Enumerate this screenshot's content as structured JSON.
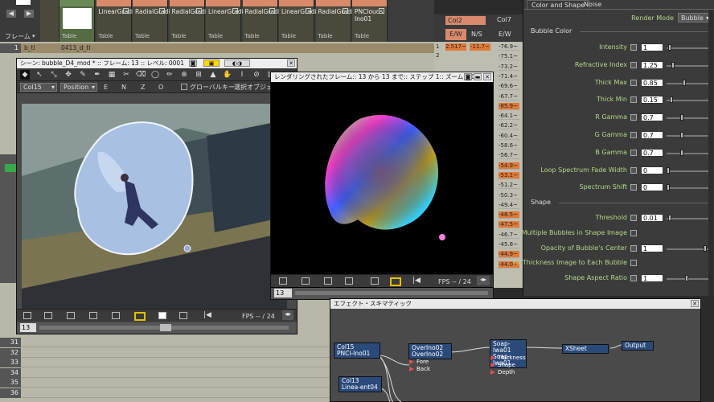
{
  "top_left": {
    "frame_label": "フレーム",
    "row_label": "1",
    "cell_value": "b_tl",
    "cell_value2": "0413_d_tl"
  },
  "columns": [
    {
      "name": "",
      "footer": ""
    },
    {
      "name": "",
      "footer": "Table"
    },
    {
      "name": "LinearGradient01",
      "footer": "Table"
    },
    {
      "name": "RadialGradient05",
      "footer": "Table"
    },
    {
      "name": "RadialGradient02",
      "footer": "Table"
    },
    {
      "name": "LinearGradient02",
      "footer": "Table"
    },
    {
      "name": "RadialGradient03",
      "footer": "Table"
    },
    {
      "name": "LinearGradient04",
      "footer": "Table"
    },
    {
      "name": "RadialGradient04",
      "footer": "Table"
    },
    {
      "name": "PNClouds Ino01",
      "footer": "Table"
    }
  ],
  "xsheet_rows": [
    "31",
    "32",
    "33",
    "34",
    "35",
    "36"
  ],
  "numcols": {
    "col2_label": "Col2",
    "col7_label": "Col7",
    "hdr_ew": "E/W",
    "hdr_ns": "N/S",
    "hdr_ew2": "E/W",
    "row1": [
      "1",
      "2.517~",
      "-11.7~",
      "-76.9~"
    ],
    "row2": "2",
    "col7_values": [
      "-76.9~",
      "-75.1~",
      "-73.2~",
      "-71.4~",
      "-69.6~",
      "-67.7~",
      "-85.9~",
      "-64.1~",
      "-62.2~",
      "-60.4~",
      "-58.6~",
      "-56.7~",
      "-54.9~",
      "-53.1~",
      "-51.2~",
      "-50.3~",
      "-49.4~",
      "-48.5~",
      "-47.5~",
      "-46.7~",
      "-45.8~",
      "-44.9~",
      "-44.0~"
    ]
  },
  "scene_window": {
    "title": "シーン: bubble_D4_mod * :: フレーム: 13 :: レベル: 0001",
    "column_select": "Col15",
    "mode_select": "Position",
    "global_key": "グローバルキー",
    "select_object": "選択オブジェ",
    "fps": "FPS -- / 24",
    "frame": "13",
    "axes": [
      "E",
      "N",
      "Z",
      "O"
    ]
  },
  "render_window": {
    "title": "レンダリングされたフレーム:: 13 から 13 まで:: ステップ 1:: ズーム: 10",
    "fps": "FPS -- / 24",
    "frame": "13"
  },
  "params": {
    "tabs": [
      "Color and Shape",
      "Noise"
    ],
    "render_mode_label": "Render Mode",
    "render_mode_value": "Bubble",
    "section_bubble_color": "Bubble Color",
    "section_shape": "Shape",
    "fields": [
      {
        "label": "Intensity",
        "value": "1",
        "level": 0.05
      },
      {
        "label": "Refractive Index",
        "value": "1.25",
        "level": 0.12
      },
      {
        "label": "Thick Max",
        "value": "0.85",
        "level": 0.42
      },
      {
        "label": "Thick Min",
        "value": "0.15",
        "level": 0.08
      },
      {
        "label": "R Gamma",
        "value": "0.7",
        "level": 0.35
      },
      {
        "label": "G Gamma",
        "value": "0.7",
        "level": 0.35
      },
      {
        "label": "B Gamma",
        "value": "0.7",
        "level": 0.35
      },
      {
        "label": "Loop Spectrum Fade Width",
        "value": "0",
        "level": 0.0
      },
      {
        "label": "Spectrum Shift",
        "value": "0",
        "level": 0.0
      }
    ],
    "shape_fields": [
      {
        "label": "Threshold",
        "value": "0.01",
        "level": 0.05
      },
      {
        "label": "Multiple Bubbles in Shape Image",
        "checkbox": true
      },
      {
        "label": "Opacity of Bubble's Center",
        "value": "1",
        "level": 0.95
      },
      {
        "label": "Fit Thickness Image to Each Bubble",
        "checkbox": true
      },
      {
        "label": "Shape Aspect Ratio",
        "value": "1",
        "level": 0.48
      }
    ]
  },
  "schematic": {
    "title": "エフェクト・スキマティック",
    "nodes": {
      "col15": [
        "Col15",
        "PNCl-Ino01"
      ],
      "col13": [
        "Col13",
        "Linea-ent04"
      ],
      "over": [
        "OverIno02",
        "OverIno02"
      ],
      "over_ports": [
        "Fore",
        "Back"
      ],
      "soap": [
        "Soap-Iwa01",
        "Soap-Iwa01"
      ],
      "soap_ports": [
        "Thickness",
        "Shape",
        "Depth"
      ],
      "xsheet": "XSheet",
      "output": "Output"
    }
  },
  "colors": {
    "accent_orange": "#e07a38",
    "param_label": "#b3d98a",
    "node_blue": "#2a4a7a"
  }
}
